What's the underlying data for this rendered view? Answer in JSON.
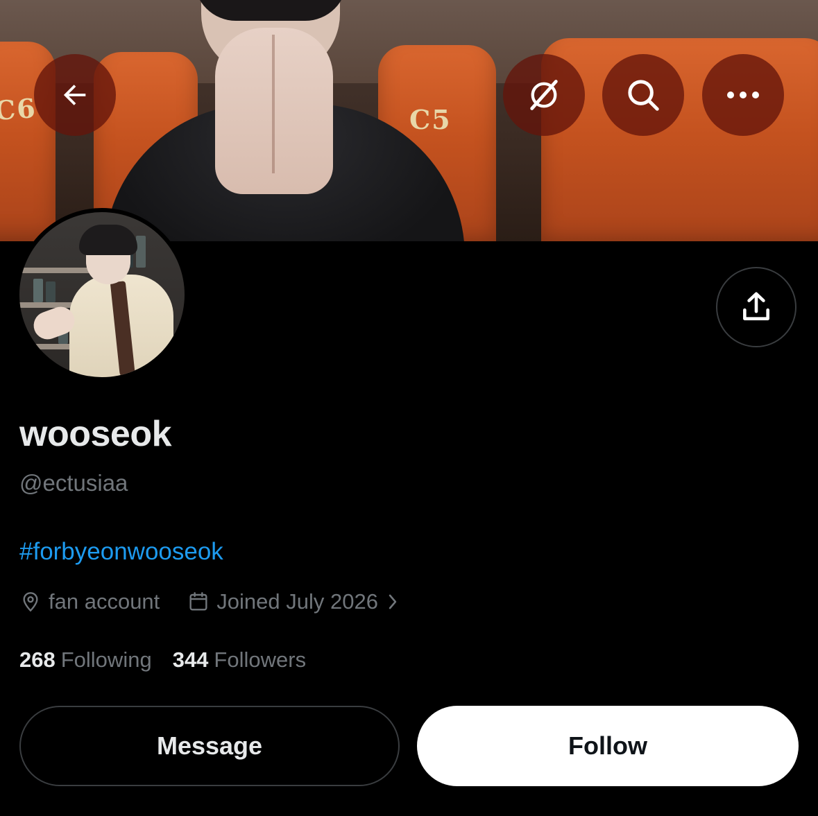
{
  "header": {
    "back_icon": "arrow-left-icon",
    "grok_icon": "grok-icon",
    "search_icon": "search-icon",
    "more_icon": "more-horizontal-icon"
  },
  "banner": {
    "seat_labels": [
      "C6",
      "C5"
    ]
  },
  "profile": {
    "display_name": "wooseok",
    "handle": "@ectusiaa",
    "bio": "#forbyeonwooseok",
    "location": "fan account",
    "joined": "Joined July 2026",
    "following_count": "268",
    "following_label": "Following",
    "followers_count": "344",
    "followers_label": "Followers",
    "share_icon": "share-icon"
  },
  "actions": {
    "message_label": "Message",
    "follow_label": "Follow"
  },
  "colors": {
    "background": "#000000",
    "text_primary": "#e7e9ea",
    "text_secondary": "#71767b",
    "link": "#1d9bf0",
    "header_button_bg": "#641409",
    "follow_bg": "#ffffff",
    "border": "#3a3d40"
  }
}
